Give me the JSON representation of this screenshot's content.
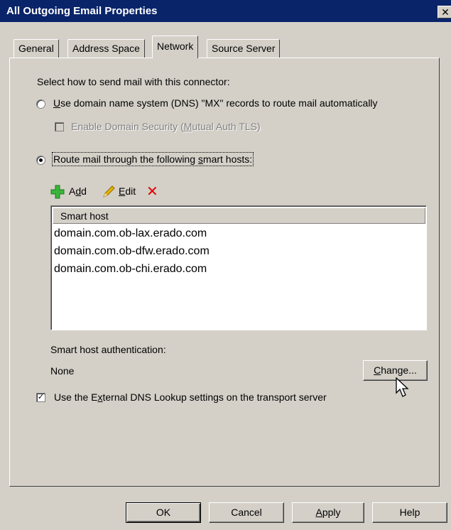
{
  "window": {
    "title": "All Outgoing Email Properties",
    "close_glyph": "✕"
  },
  "tabs": [
    {
      "label": "General"
    },
    {
      "label": "Address Space"
    },
    {
      "label": "Network",
      "active": true
    },
    {
      "label": "Source Server"
    }
  ],
  "network": {
    "prompt": "Select how to send mail with this connector:",
    "dns_option": {
      "u": "U",
      "rest": "se domain name system (DNS) \"MX\" records to route mail automatically",
      "selected": false
    },
    "domain_security": {
      "pre": "Enable Domain Security (",
      "u": "M",
      "post": "utual Auth TLS)",
      "checked": false,
      "enabled": false
    },
    "smarthost_option": {
      "pre": "Route mail through the following ",
      "u": "s",
      "post": "mart hosts:",
      "selected": true
    },
    "toolbar": {
      "add": {
        "pre": "A",
        "u": "d",
        "post": "d"
      },
      "edit": {
        "u": "E",
        "post": "dit"
      },
      "delete_glyph": "✕"
    },
    "list": {
      "column_header": "Smart host",
      "rows": [
        "domain.com.ob-lax.erado.com",
        "domain.com.ob-dfw.erado.com",
        "domain.com.ob-chi.erado.com"
      ]
    },
    "auth_label": "Smart host authentication:",
    "auth_value": "None",
    "change_button": {
      "u": "C",
      "post": "hange..."
    },
    "external_dns": {
      "pre": "Use the E",
      "u": "x",
      "post": "ternal DNS Lookup settings on the transport server",
      "checked": true,
      "check_glyph": "✓"
    }
  },
  "footer": {
    "ok": "OK",
    "cancel": "Cancel",
    "apply": {
      "u": "A",
      "post": "pply"
    },
    "help": "Help"
  },
  "colors": {
    "titlebar": "#0a246a",
    "face": "#d4d0c8",
    "add_icon": "#3cb43c",
    "delete_icon": "#e00000",
    "edit_icon": "#e8b400"
  }
}
